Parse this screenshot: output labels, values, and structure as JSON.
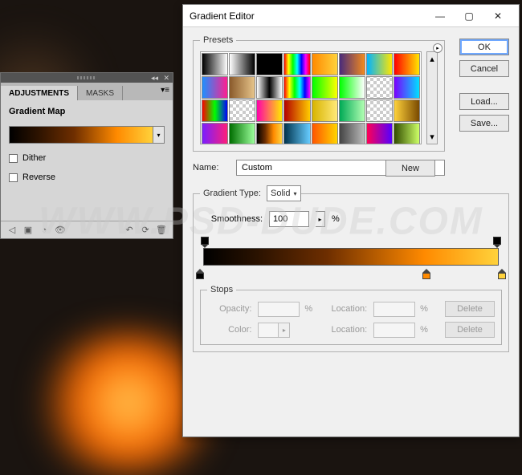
{
  "watermark": "WWW.PSD-DUDE.COM",
  "adjustments_panel": {
    "tabs": {
      "adjustments": "ADJUSTMENTS",
      "masks": "MASKS"
    },
    "title": "Gradient Map",
    "dither_label": "Dither",
    "reverse_label": "Reverse",
    "gradient_css": "linear-gradient(90deg,#000 0%,#2d1300 20%,#6e2e00 45%,#ff8a00 75%,#ffd23b 100%)"
  },
  "dialog": {
    "title": "Gradient Editor",
    "buttons": {
      "ok": "OK",
      "cancel": "Cancel",
      "load": "Load...",
      "save": "Save...",
      "new": "New"
    },
    "presets_label": "Presets",
    "name_label": "Name:",
    "name_value": "Custom",
    "gradient_type_label": "Gradient Type:",
    "gradient_type_value": "Solid",
    "smoothness_label": "Smoothness:",
    "smoothness_value": "100",
    "smoothness_unit": "%",
    "stops_label": "Stops",
    "opacity_label": "Opacity:",
    "color_label": "Color:",
    "location_label": "Location:",
    "pct": "%",
    "delete_label": "Delete",
    "preset_swatches": [
      "linear-gradient(90deg,#000,#fff)",
      "linear-gradient(90deg,#fff,#000)",
      "linear-gradient(90deg,#000,#000)",
      "linear-gradient(90deg,#f00,#ff0,#0f0,#0ff,#00f,#f0f,#f00)",
      "linear-gradient(90deg,#ff8a00,#ffd23b)",
      "linear-gradient(90deg,#4a2b7a,#f28a1e)",
      "linear-gradient(90deg,#00b3ff,#ffe600)",
      "linear-gradient(90deg,#ff0000,#ffe600)",
      "linear-gradient(90deg,#1e90ff,#ff1e90)",
      "linear-gradient(90deg,#8a5a2b,#e6c48a)",
      "linear-gradient(90deg,#fff,#000,#fff)",
      "linear-gradient(90deg,#f00,#ff0,#0f0,#0ff,#00f,#f0f)",
      "linear-gradient(90deg,#0f0,#ff0)",
      "linear-gradient(90deg,#0f0,transparent)",
      "repeating-conic-gradient(#ccc 0 25%,#fff 0 50%) 0/8px 8px",
      "linear-gradient(90deg,#7a00ff,#00e1ff)",
      "linear-gradient(90deg,#ff0000,#00ff00,#0000ff)",
      "repeating-conic-gradient(#ccc 0 25%,#fff 0 50%) 0/8px 8px",
      "linear-gradient(90deg,#ff00aa,#ffea00)",
      "linear-gradient(90deg,#b30000,#ffcc00)",
      "linear-gradient(90deg,#d8b400,#ffe97a)",
      "linear-gradient(90deg,#00aa55,#b3ffb3)",
      "repeating-conic-gradient(#ccc 0 25%,#fff 0 50%) 0/8px 8px",
      "linear-gradient(90deg,#ffd23b,#7a4a00)",
      "linear-gradient(90deg,#7a1eff,#ff1e7a)",
      "linear-gradient(90deg,#006e00,#9bff9b)",
      "linear-gradient(90deg,#000,#6e2e00,#ff8a00,#ffd23b)",
      "linear-gradient(90deg,#00334d,#66ccff)",
      "linear-gradient(90deg,#ff5500,#ffd500)",
      "linear-gradient(90deg,#444,#bbb)",
      "linear-gradient(90deg,#ff0055,#5500ff)",
      "linear-gradient(90deg,#334d00,#ccff66)"
    ],
    "gradient_bar_css": "linear-gradient(90deg,#000 0%,#2a1200 18%,#6e2e00 42%,#ff8a00 75%,#ffd23b 100%)",
    "opacity_stops_pct": [
      0,
      100
    ],
    "color_stops": [
      {
        "pct": 0,
        "color": "#000000"
      },
      {
        "pct": 75,
        "color": "#ff8a00"
      },
      {
        "pct": 100,
        "color": "#ffd23b"
      }
    ]
  }
}
